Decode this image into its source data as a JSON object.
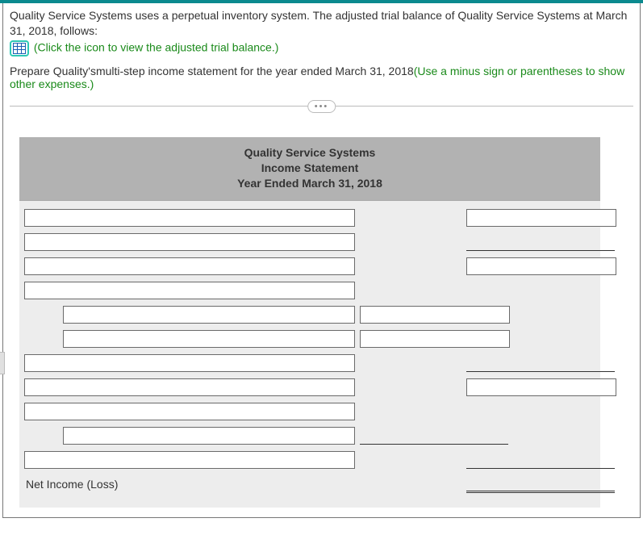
{
  "question": {
    "intro": "Quality Service Systems uses a perpetual inventory system. The adjusted trial balance of Quality Service Systems at March 31, 2018, follows:",
    "link_text": "(Click the icon to view the adjusted trial balance.)",
    "task_prefix": "Prepare Quality'smulti-step income statement for the year ended March 31, 2018",
    "task_hint": "(Use a minus sign or parentheses to show other expenses.)",
    "pill": "•••"
  },
  "worksheet": {
    "header": {
      "company": "Quality Service Systems",
      "title": "Income Statement",
      "period": "Year Ended March 31, 2018"
    },
    "final_label": "Net Income (Loss)"
  },
  "fields": {
    "l1": "",
    "r1": "",
    "l2": "",
    "u2": "",
    "l3": "",
    "r3": "",
    "l4": "",
    "l5": "",
    "m5": "",
    "l6": "",
    "m6": "",
    "l7": "",
    "u7": "",
    "l8": "",
    "r8": "",
    "l9": "",
    "l10": "",
    "u10": "",
    "l11": "",
    "u11": "",
    "dfinal": ""
  }
}
